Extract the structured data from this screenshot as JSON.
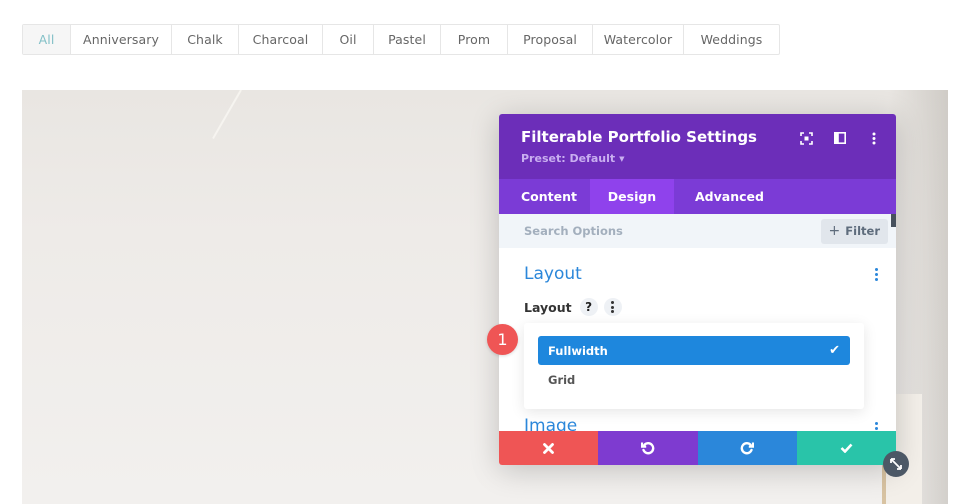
{
  "filters": {
    "items": [
      {
        "label": "All",
        "active": true
      },
      {
        "label": "Anniversary",
        "active": false
      },
      {
        "label": "Chalk",
        "active": false
      },
      {
        "label": "Charcoal",
        "active": false
      },
      {
        "label": "Oil",
        "active": false
      },
      {
        "label": "Pastel",
        "active": false
      },
      {
        "label": "Prom",
        "active": false
      },
      {
        "label": "Proposal",
        "active": false
      },
      {
        "label": "Watercolor",
        "active": false
      },
      {
        "label": "Weddings",
        "active": false
      }
    ]
  },
  "modal": {
    "title": "Filterable Portfolio Settings",
    "preset": "Preset: Default",
    "header_icons": [
      "focus-icon",
      "split-view-icon",
      "more-options-icon"
    ],
    "tabs": [
      {
        "label": "Content",
        "active": false
      },
      {
        "label": "Design",
        "active": true
      },
      {
        "label": "Advanced",
        "active": false
      }
    ],
    "search": {
      "placeholder": "Search Options",
      "value": ""
    },
    "filter_button": "Filter",
    "sections": [
      {
        "title": "Layout"
      },
      {
        "title": "Image"
      }
    ],
    "layout_field": {
      "label": "Layout",
      "help_label": "?",
      "options": [
        {
          "label": "Fullwidth",
          "selected": true
        },
        {
          "label": "Grid",
          "selected": false
        }
      ]
    },
    "footer": {
      "cancel": "cancel",
      "undo": "undo",
      "redo": "redo",
      "save": "save"
    }
  },
  "annotation": {
    "step": "1"
  },
  "colors": {
    "header_purple": "#6c2eb9",
    "tab_purple": "#7b3bd6",
    "active_tab": "#8f42ec",
    "accent_blue": "#2b87da",
    "selected_blue": "#1e87dd",
    "cancel_red": "#ef5555",
    "save_teal": "#29c4a9",
    "filter_active": "#82c0c7"
  }
}
